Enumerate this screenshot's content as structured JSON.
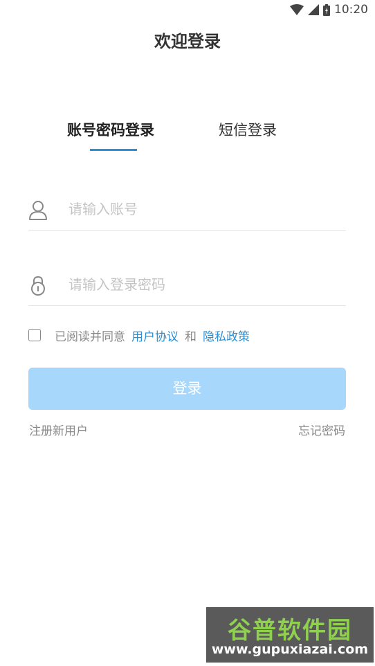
{
  "status_bar": {
    "time": "10:20",
    "icons": [
      "wifi-icon",
      "signal-icon",
      "battery-icon"
    ]
  },
  "header": {
    "title": "欢迎登录"
  },
  "tabs": [
    {
      "label": "账号密码登录",
      "active": true
    },
    {
      "label": "短信登录",
      "active": false
    }
  ],
  "form": {
    "account": {
      "icon": "user-icon",
      "placeholder": "请输入账号",
      "value": ""
    },
    "password": {
      "icon": "lock-icon",
      "placeholder": "请输入登录密码",
      "value": ""
    },
    "agreement": {
      "checked": false,
      "prefix": "已阅读并同意",
      "user_agreement": "用户协议",
      "and": "和",
      "privacy_policy": "隐私政策"
    },
    "login_button": "登录",
    "register": "注册新用户",
    "forgot_password": "忘记密码"
  },
  "colors": {
    "accent": "#2b8fd4",
    "button_disabled": "#a7d7fb",
    "text_primary": "#333333",
    "text_secondary": "#888888",
    "placeholder": "#c4c4c4"
  },
  "watermark": {
    "name": "谷普软件园",
    "url": "www.gupuxiazai.com"
  }
}
